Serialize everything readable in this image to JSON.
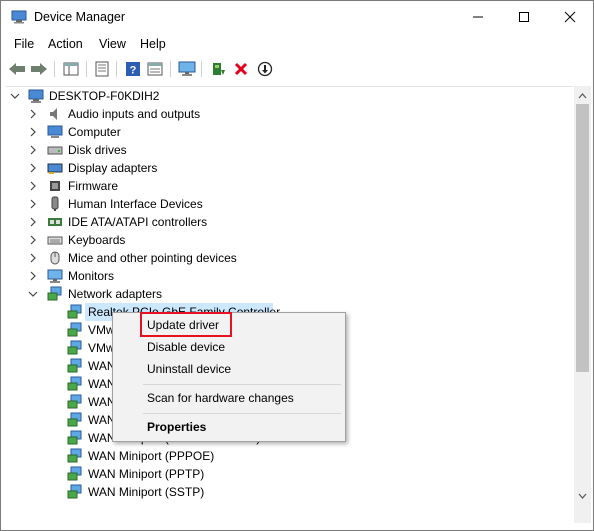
{
  "window": {
    "title": "Device Manager"
  },
  "menu": [
    "File",
    "Action",
    "View",
    "Help"
  ],
  "toolbar": {
    "buttons": [
      "back-icon",
      "forward-icon",
      "properties-sheet-icon",
      "list-icon",
      "help-icon",
      "view-icon",
      "monitor-icon",
      "update-driver-icon",
      "uninstall-icon",
      "download-icon"
    ]
  },
  "tree": {
    "root": "DESKTOP-F0KDIH2",
    "categories": [
      "Audio inputs and outputs",
      "Computer",
      "Disk drives",
      "Display adapters",
      "Firmware",
      "Human Interface Devices",
      "IDE ATA/ATAPI controllers",
      "Keyboards",
      "Mice and other pointing devices",
      "Monitors",
      "Network adapters"
    ],
    "network_children": [
      "Realtek PCIe GbE Family Controller",
      "VMware Virtual Ethernet Adapter for VMnet1",
      "VMware Virtual Ethernet Adapter for VMnet8",
      "WAN Miniport (IKEv2)",
      "WAN Miniport (IP)",
      "WAN Miniport (IPv6)",
      "WAN Miniport (L2TP)",
      "WAN Miniport (Network Monitor)",
      "WAN Miniport (PPPOE)",
      "WAN Miniport (PPTP)",
      "WAN Miniport (SSTP)"
    ]
  },
  "context_menu": {
    "update_driver": "Update driver",
    "disable_device": "Disable device",
    "uninstall_device": "Uninstall device",
    "scan": "Scan for hardware changes",
    "properties": "Properties"
  },
  "colors": {
    "highlight": "#e81123",
    "selection": "#cce8ff"
  }
}
